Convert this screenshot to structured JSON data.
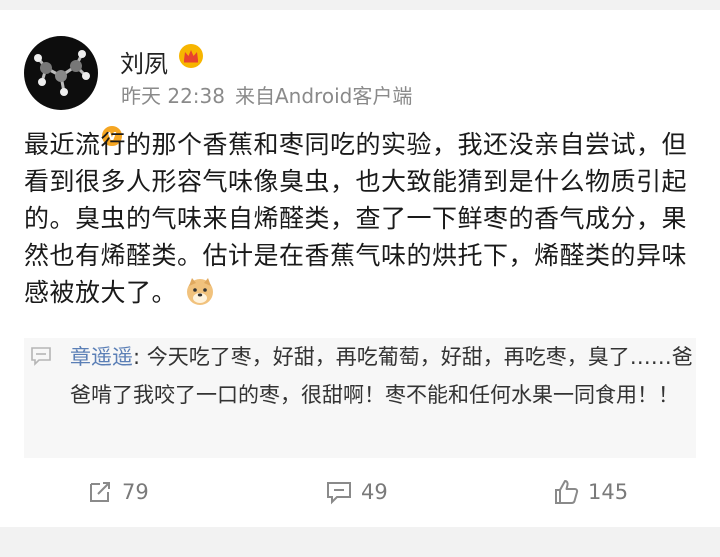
{
  "post": {
    "author": "刘夙",
    "time": "昨天 22:38",
    "source": "来自Android客户端",
    "text": "最近流行的那个香蕉和枣同吃的实验，我还没亲自尝试，但看到很多人形容气味像臭虫，也大致能猜到是什么物质引起的。臭虫的气味来自烯醛类，查了一下鲜枣的香气成分，果然也有烯醛类。估计是在香蕉气味的烘托下，烯醛类的异味感被放大了。"
  },
  "comment": {
    "author": "章遥遥",
    "separator": ":",
    "text": " 今天吃了枣，好甜，再吃葡萄，好甜，再吃枣，臭了……爸爸啃了我咬了一口的枣，很甜啊！枣不能和任何水果一同食用！！"
  },
  "actions": {
    "repost_count": "79",
    "comment_count": "49",
    "like_count": "145"
  },
  "colors": {
    "link": "#5b7fb6",
    "meta": "#8a8a8a",
    "verified": "#f5a623"
  },
  "icons": [
    "molecule-avatar",
    "verified-badge-icon",
    "crown-icon",
    "doge-emoji-icon",
    "comment-icon",
    "repost-icon",
    "comment-count-icon",
    "like-icon"
  ]
}
